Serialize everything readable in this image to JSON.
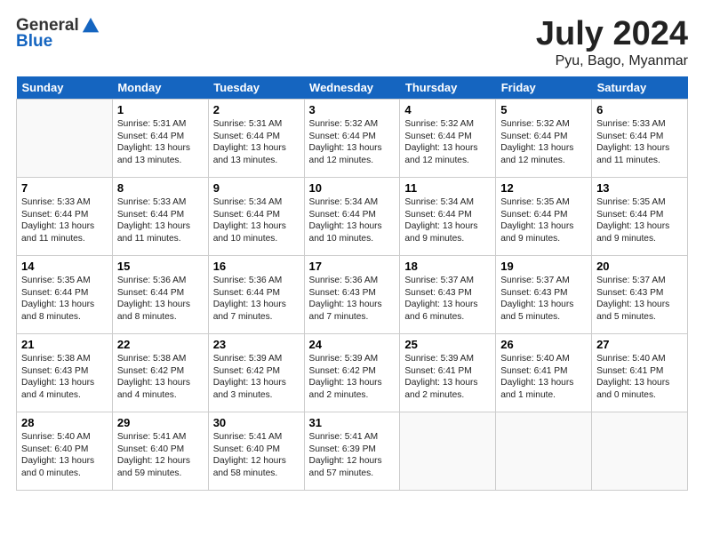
{
  "header": {
    "logo_general": "General",
    "logo_blue": "Blue",
    "title": "July 2024",
    "subtitle": "Pyu, Bago, Myanmar"
  },
  "days": [
    "Sunday",
    "Monday",
    "Tuesday",
    "Wednesday",
    "Thursday",
    "Friday",
    "Saturday"
  ],
  "weeks": [
    [
      {
        "date": "",
        "text": ""
      },
      {
        "date": "1",
        "text": "Sunrise: 5:31 AM\nSunset: 6:44 PM\nDaylight: 13 hours\nand 13 minutes."
      },
      {
        "date": "2",
        "text": "Sunrise: 5:31 AM\nSunset: 6:44 PM\nDaylight: 13 hours\nand 13 minutes."
      },
      {
        "date": "3",
        "text": "Sunrise: 5:32 AM\nSunset: 6:44 PM\nDaylight: 13 hours\nand 12 minutes."
      },
      {
        "date": "4",
        "text": "Sunrise: 5:32 AM\nSunset: 6:44 PM\nDaylight: 13 hours\nand 12 minutes."
      },
      {
        "date": "5",
        "text": "Sunrise: 5:32 AM\nSunset: 6:44 PM\nDaylight: 13 hours\nand 12 minutes."
      },
      {
        "date": "6",
        "text": "Sunrise: 5:33 AM\nSunset: 6:44 PM\nDaylight: 13 hours\nand 11 minutes."
      }
    ],
    [
      {
        "date": "7",
        "text": "Sunrise: 5:33 AM\nSunset: 6:44 PM\nDaylight: 13 hours\nand 11 minutes."
      },
      {
        "date": "8",
        "text": "Sunrise: 5:33 AM\nSunset: 6:44 PM\nDaylight: 13 hours\nand 11 minutes."
      },
      {
        "date": "9",
        "text": "Sunrise: 5:34 AM\nSunset: 6:44 PM\nDaylight: 13 hours\nand 10 minutes."
      },
      {
        "date": "10",
        "text": "Sunrise: 5:34 AM\nSunset: 6:44 PM\nDaylight: 13 hours\nand 10 minutes."
      },
      {
        "date": "11",
        "text": "Sunrise: 5:34 AM\nSunset: 6:44 PM\nDaylight: 13 hours\nand 9 minutes."
      },
      {
        "date": "12",
        "text": "Sunrise: 5:35 AM\nSunset: 6:44 PM\nDaylight: 13 hours\nand 9 minutes."
      },
      {
        "date": "13",
        "text": "Sunrise: 5:35 AM\nSunset: 6:44 PM\nDaylight: 13 hours\nand 9 minutes."
      }
    ],
    [
      {
        "date": "14",
        "text": "Sunrise: 5:35 AM\nSunset: 6:44 PM\nDaylight: 13 hours\nand 8 minutes."
      },
      {
        "date": "15",
        "text": "Sunrise: 5:36 AM\nSunset: 6:44 PM\nDaylight: 13 hours\nand 8 minutes."
      },
      {
        "date": "16",
        "text": "Sunrise: 5:36 AM\nSunset: 6:44 PM\nDaylight: 13 hours\nand 7 minutes."
      },
      {
        "date": "17",
        "text": "Sunrise: 5:36 AM\nSunset: 6:43 PM\nDaylight: 13 hours\nand 7 minutes."
      },
      {
        "date": "18",
        "text": "Sunrise: 5:37 AM\nSunset: 6:43 PM\nDaylight: 13 hours\nand 6 minutes."
      },
      {
        "date": "19",
        "text": "Sunrise: 5:37 AM\nSunset: 6:43 PM\nDaylight: 13 hours\nand 5 minutes."
      },
      {
        "date": "20",
        "text": "Sunrise: 5:37 AM\nSunset: 6:43 PM\nDaylight: 13 hours\nand 5 minutes."
      }
    ],
    [
      {
        "date": "21",
        "text": "Sunrise: 5:38 AM\nSunset: 6:43 PM\nDaylight: 13 hours\nand 4 minutes."
      },
      {
        "date": "22",
        "text": "Sunrise: 5:38 AM\nSunset: 6:42 PM\nDaylight: 13 hours\nand 4 minutes."
      },
      {
        "date": "23",
        "text": "Sunrise: 5:39 AM\nSunset: 6:42 PM\nDaylight: 13 hours\nand 3 minutes."
      },
      {
        "date": "24",
        "text": "Sunrise: 5:39 AM\nSunset: 6:42 PM\nDaylight: 13 hours\nand 2 minutes."
      },
      {
        "date": "25",
        "text": "Sunrise: 5:39 AM\nSunset: 6:41 PM\nDaylight: 13 hours\nand 2 minutes."
      },
      {
        "date": "26",
        "text": "Sunrise: 5:40 AM\nSunset: 6:41 PM\nDaylight: 13 hours\nand 1 minute."
      },
      {
        "date": "27",
        "text": "Sunrise: 5:40 AM\nSunset: 6:41 PM\nDaylight: 13 hours\nand 0 minutes."
      }
    ],
    [
      {
        "date": "28",
        "text": "Sunrise: 5:40 AM\nSunset: 6:40 PM\nDaylight: 13 hours\nand 0 minutes."
      },
      {
        "date": "29",
        "text": "Sunrise: 5:41 AM\nSunset: 6:40 PM\nDaylight: 12 hours\nand 59 minutes."
      },
      {
        "date": "30",
        "text": "Sunrise: 5:41 AM\nSunset: 6:40 PM\nDaylight: 12 hours\nand 58 minutes."
      },
      {
        "date": "31",
        "text": "Sunrise: 5:41 AM\nSunset: 6:39 PM\nDaylight: 12 hours\nand 57 minutes."
      },
      {
        "date": "",
        "text": ""
      },
      {
        "date": "",
        "text": ""
      },
      {
        "date": "",
        "text": ""
      }
    ]
  ]
}
